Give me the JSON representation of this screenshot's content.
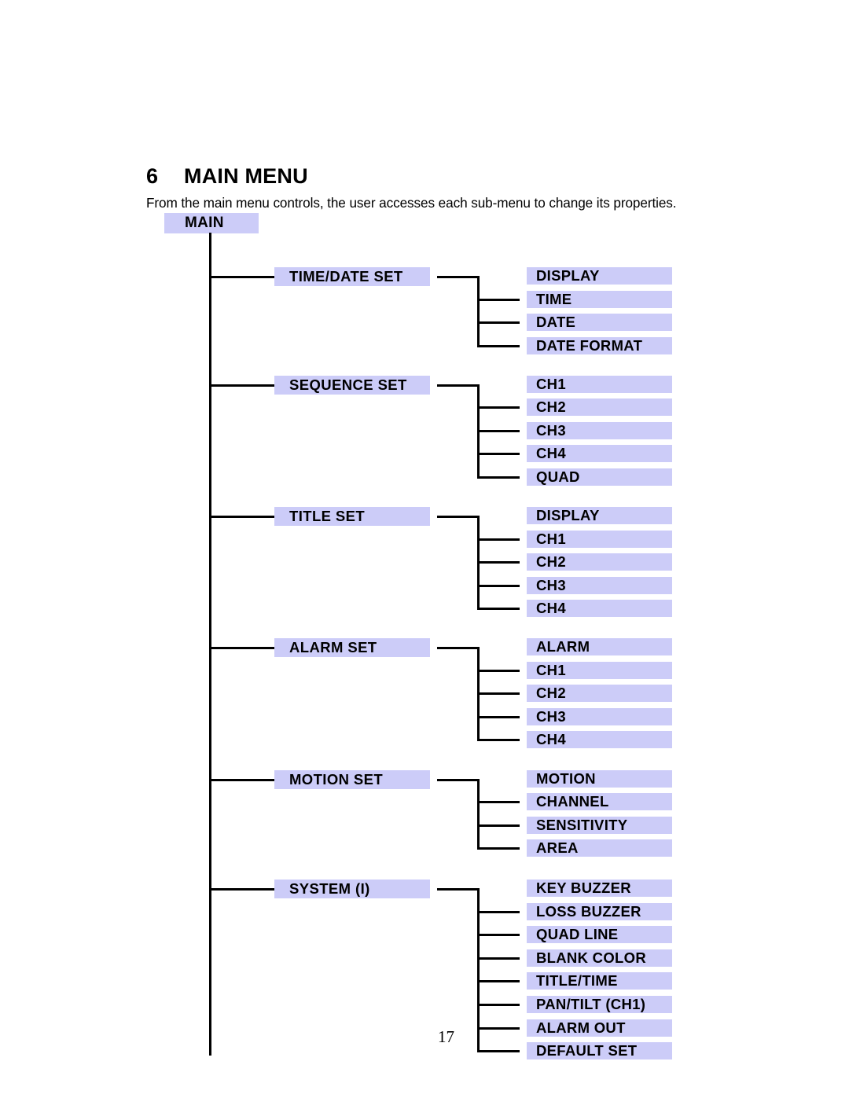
{
  "document": {
    "section_number": "6",
    "section_title": "MAIN MENU",
    "intro": "From the main menu controls, the user accesses each sub-menu to change its properties.",
    "page_number": "17"
  },
  "colors": {
    "box_fill": "#ccccf8",
    "line": "#000000",
    "text": "#000000"
  },
  "tree": {
    "root": {
      "label": "MAIN"
    },
    "branches": [
      {
        "label": "TIME/DATE SET",
        "children": [
          {
            "label": "DISPLAY"
          },
          {
            "label": "TIME"
          },
          {
            "label": "DATE"
          },
          {
            "label": "DATE FORMAT"
          }
        ]
      },
      {
        "label": "SEQUENCE SET",
        "children": [
          {
            "label": "CH1"
          },
          {
            "label": "CH2"
          },
          {
            "label": "CH3"
          },
          {
            "label": "CH4"
          },
          {
            "label": "QUAD"
          }
        ]
      },
      {
        "label": "TITLE SET",
        "children": [
          {
            "label": "DISPLAY"
          },
          {
            "label": "CH1"
          },
          {
            "label": "CH2"
          },
          {
            "label": "CH3"
          },
          {
            "label": "CH4"
          }
        ]
      },
      {
        "label": "ALARM SET",
        "children": [
          {
            "label": "ALARM"
          },
          {
            "label": "CH1"
          },
          {
            "label": "CH2"
          },
          {
            "label": "CH3"
          },
          {
            "label": "CH4"
          }
        ]
      },
      {
        "label": "MOTION SET",
        "children": [
          {
            "label": "MOTION"
          },
          {
            "label": "CHANNEL"
          },
          {
            "label": "SENSITIVITY"
          },
          {
            "label": "AREA"
          }
        ]
      },
      {
        "label": "SYSTEM (I)",
        "children": [
          {
            "label": "KEY BUZZER"
          },
          {
            "label": "LOSS BUZZER"
          },
          {
            "label": "QUAD LINE"
          },
          {
            "label": "BLANK COLOR"
          },
          {
            "label": "TITLE/TIME"
          },
          {
            "label": "PAN/TILT (CH1)"
          },
          {
            "label": "ALARM OUT"
          },
          {
            "label": "DEFAULT SET"
          }
        ]
      }
    ]
  }
}
